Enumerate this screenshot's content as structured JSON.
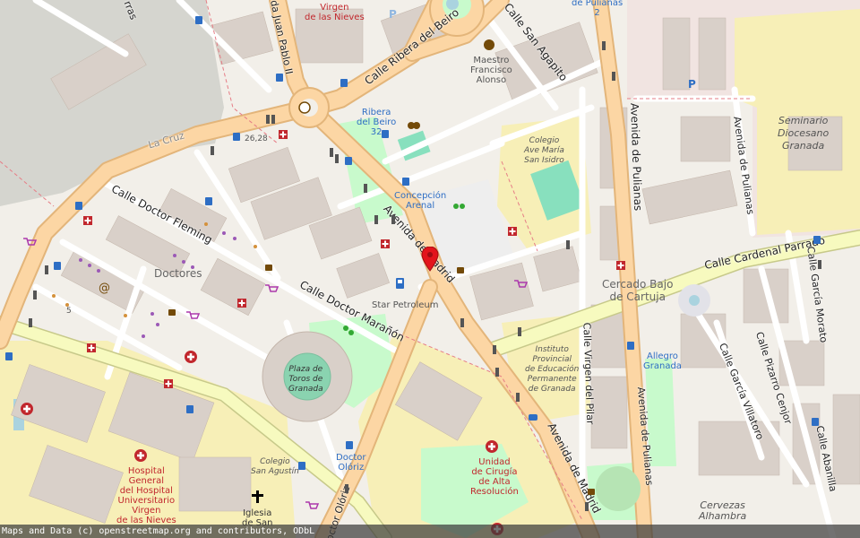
{
  "map": {
    "streets": {
      "calle_ribera_del_beiro": "Calle Ribera del Beiro",
      "calle_san_agapito": "Calle San Agapito",
      "avenida_juan_pablo_ii": "da Juan Pablo II",
      "la_cruz": "La Cruz",
      "calle_doctor_fleming": "Calle Doctor Fleming",
      "calle_doctor_maranon": "Calle Doctor Marañón",
      "avenida_de_madrid_1": "Avenida de Madrid",
      "avenida_de_madrid_2": "Avenida de Madrid",
      "avenida_de_pulianas_1": "Avenida de Pulianas",
      "avenida_de_pulianas_2": "Avenida de Pulianas",
      "avenida_de_pulianas_3": "Avenida de Pulianas",
      "calle_cardenal_parrado": "Calle Cardenal Parrado",
      "calle_garcia_morato": "Calle García Morato",
      "calle_garcia_villatoro": "Calle García Villatoro",
      "calle_pizarro_cenjor": "Calle Pizarro Cenjor",
      "calle_abanilla": "Calle Abanilla",
      "calle_virgen_del_pilar": "Calle Virgen del Pilar",
      "doctor_oloriz_street": "Doctor Olóriz",
      "top_left_street": "rras"
    },
    "places": {
      "virgen_de_las_nieves": "Virgen\nde las Nieves",
      "pulianas_2": "de Pulianas\n2",
      "maestro_francisco_alonso": "Maestro\nFrancisco\nAlonso",
      "ribera_del_beiro_32": "Ribera\ndel Beiro\n32",
      "concepcion_arenal": "Concepción\nArenal",
      "colegio_ave_maria": "Colegio\nAve María\nSan Isidro",
      "seminario": "Seminario\nDiocesano\nGranada",
      "doctores": "Doctores",
      "star_petroleum": "Star Petroleum",
      "cercado_bajo": "Cercado Bajo\nde Cartuja",
      "plaza_de_toros": "Plaza de\nToros de\nGranada",
      "instituto": "Instituto\nProvincial\nde Educación\nPermanente\nde Granada",
      "allegro_granada": "Allegro\nGranada",
      "colegio_san_agustin": "Colegio\nSan Agustín",
      "doctor_oloriz_stop": "Doctor\nOlóriz",
      "unidad_cirugia": "Unidad\nde Cirugía\nde Alta\nResolución",
      "hospital_general": "Hospital\nGeneral\ndel Hospital\nUniversitario\nVirgen\nde las Nieves",
      "iglesia": "Iglesia\nde San",
      "cervezas_alhambra": "Cervezas\nAlhambra",
      "house_26_28": "26,28",
      "house_5": "5"
    },
    "attribution": "Maps and Data (c) openstreetmap.org and contributors, ODbL",
    "colors": {
      "background": "#f2efe9",
      "major_road": "#fcd6a4",
      "major_road_casing": "#e3b57a",
      "secondary_road": "#f7fabf",
      "secondary_road_casing": "#c7c98a",
      "building": "#d9d0c9",
      "park": "#c8facc",
      "grass": "#cdebb0",
      "water": "#aad3df",
      "industrial": "#ebdbe8",
      "parking": "#eeeeee",
      "marker": "#e3151b"
    }
  }
}
